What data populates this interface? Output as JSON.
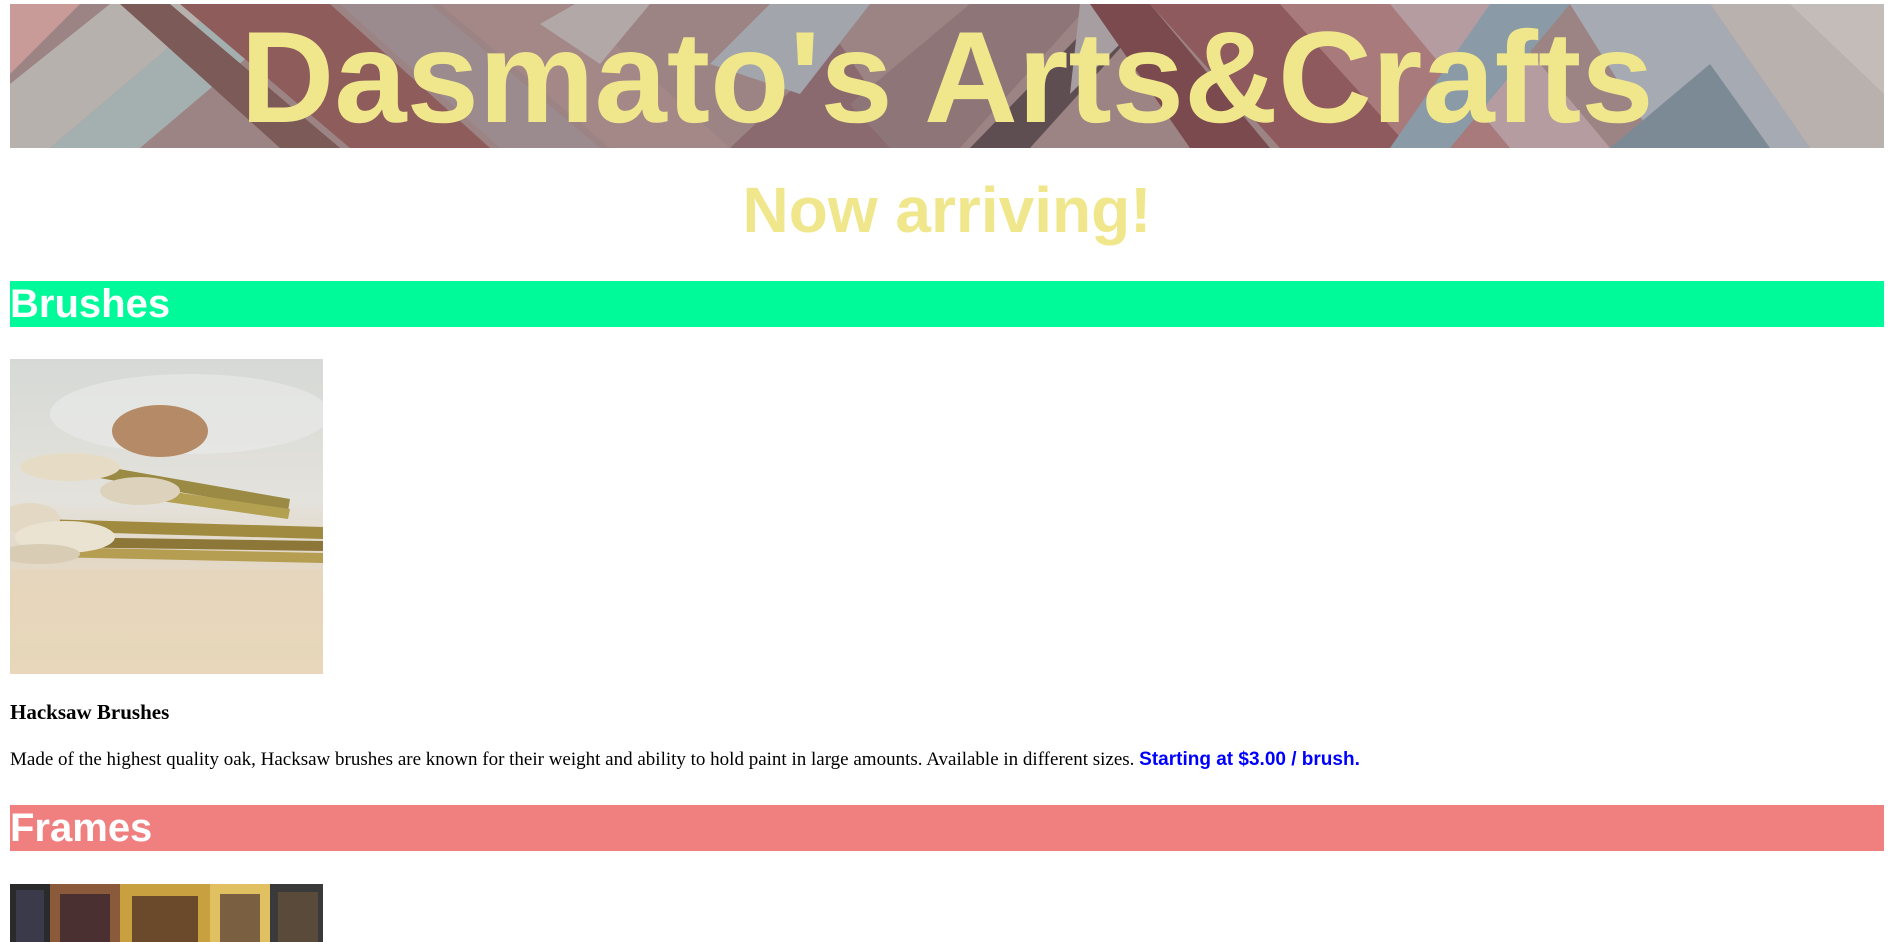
{
  "header": {
    "title": "Dasmato's Arts&Crafts",
    "title_color": "#f0e68c"
  },
  "announcement": {
    "text": "Now arriving!"
  },
  "sections": [
    {
      "title": "Brushes",
      "color": "#00fa9a",
      "product": {
        "name": "Hacksaw Brushes",
        "description": "Made of the highest quality oak, Hacksaw brushes are known for their weight and ability to hold paint in large amounts. Available in different sizes.",
        "price": "Starting at $3.00 / brush.",
        "price_color": "#0000ff"
      }
    },
    {
      "title": "Frames",
      "color": "#f08080"
    }
  ]
}
